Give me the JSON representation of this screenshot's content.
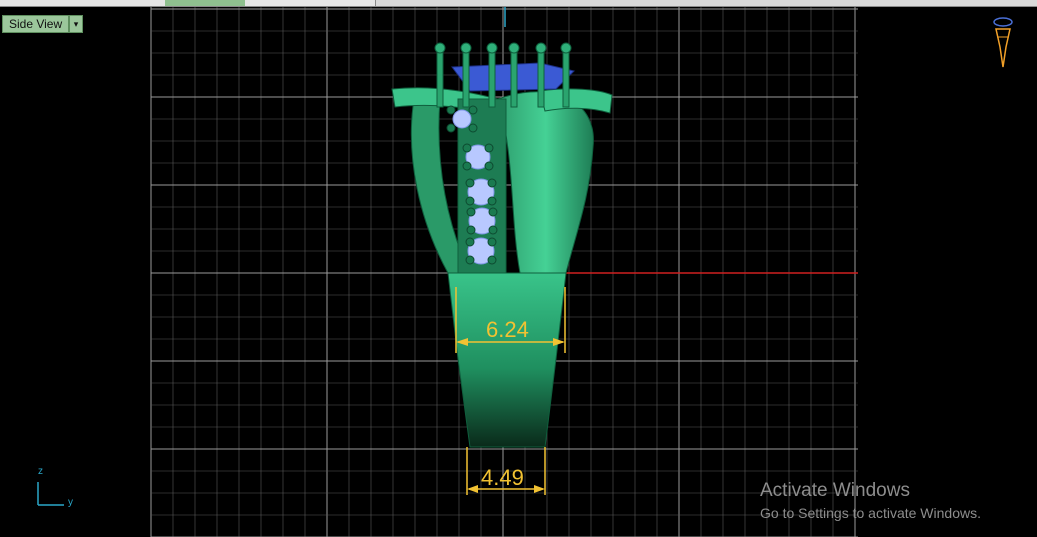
{
  "viewport": {
    "view_name": "Side View",
    "dropdown_glyph": "▾"
  },
  "dimensions": {
    "upper_width": "6.24",
    "lower_width": "4.49"
  },
  "axes": {
    "vertical": "z",
    "horizontal": "y"
  },
  "activation_watermark": {
    "title": "Activate Windows",
    "subtitle": "Go to Settings to activate Windows."
  },
  "colors": {
    "grid": "#5a5a5a",
    "model": "#2fb07a",
    "gem": "#b8c8ff",
    "dimension": "#f2c232",
    "axis_red": "#d02020",
    "axis_cyan": "#2aa7c9"
  },
  "icons": {
    "dropdown": "chevron-down-icon",
    "orientation_widget": "ring-orientation-icon"
  }
}
